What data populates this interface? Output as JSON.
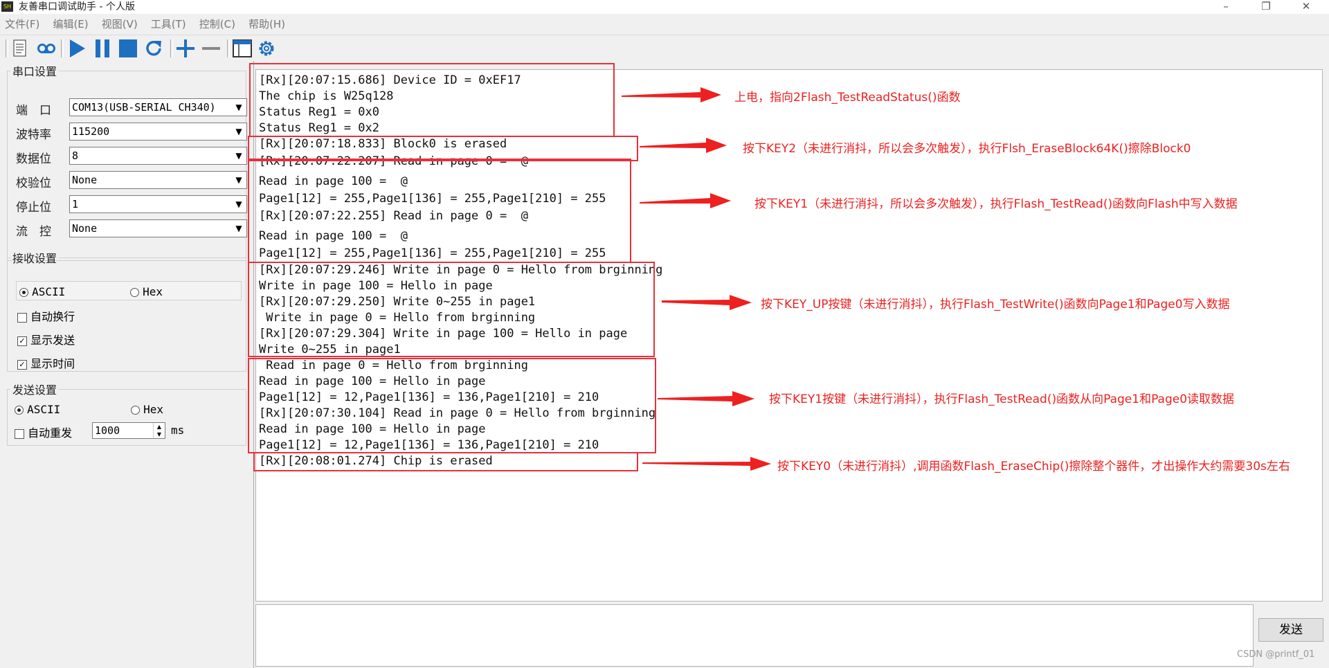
{
  "window": {
    "title": "友善串口调试助手 - 个人版",
    "icon": "app-icon"
  },
  "menu": [
    "文件(F)",
    "编辑(E)",
    "视图(V)",
    "工具(T)",
    "控制(C)",
    "帮助(H)"
  ],
  "toolbar_icons": [
    "new-document-icon",
    "record-icon",
    "play-icon",
    "pause-icon",
    "stop-icon",
    "refresh-icon",
    "add-icon",
    "remove-icon",
    "window-icon",
    "settings-gear-icon"
  ],
  "serial_settings": {
    "title": "串口设置",
    "rows": [
      {
        "label": "端　口",
        "value": "COM13(USB-SERIAL CH340)"
      },
      {
        "label": "波特率",
        "value": "115200"
      },
      {
        "label": "数据位",
        "value": "8"
      },
      {
        "label": "校验位",
        "value": "None"
      },
      {
        "label": "停止位",
        "value": "1"
      },
      {
        "label": "流　控",
        "value": "None"
      }
    ]
  },
  "receive_settings": {
    "title": "接收设置",
    "ascii": "ASCII",
    "hex": "Hex",
    "auto_wrap": "自动换行",
    "show_send": "显示发送",
    "show_time": "显示时间"
  },
  "send_settings": {
    "title": "发送设置",
    "ascii": "ASCII",
    "hex": "Hex",
    "auto_resend": "自动重发",
    "interval": "1000",
    "unit": "ms"
  },
  "receive_lines": [
    "[Rx][20:07:15.686] Device ID = 0xEF17",
    "The chip is W25q128",
    "Status Reg1 = 0x0",
    "Status Reg1 = 0x2",
    "[Rx][20:07:18.833] Block0 is erased",
    "[Rx][20:07:22.207] Read in page 0 =  @",
    "Read in page 100 =  @",
    "Page1[12] = 255,Page1[136] = 255,Page1[210] = 255",
    "[Rx][20:07:22.255] Read in page 0 =  @",
    "Read in page 100 =  @",
    "Page1[12] = 255,Page1[136] = 255,Page1[210] = 255",
    "[Rx][20:07:29.246] Write in page 0 = Hello from brginning",
    "Write in page 100 = Hello in page",
    "[Rx][20:07:29.250] Write 0~255 in page1",
    " Write in page 0 = Hello from brginning",
    "[Rx][20:07:29.304] Write in page 100 = Hello in page",
    "Write 0~255 in page1",
    " Read in page 0 = Hello from brginning",
    "Read in page 100 = Hello in page",
    "Page1[12] = 12,Page1[136] = 136,Page1[210] = 210",
    "[Rx][20:07:30.104] Read in page 0 = Hello from brginning",
    "Read in page 100 = Hello in page",
    "Page1[12] = 12,Page1[136] = 136,Page1[210] = 210",
    "[Rx][20:08:01.274] Chip is erased"
  ],
  "annotations": [
    "上电，指向2Flash_TestReadStatus()函数",
    "按下KEY2（未进行消抖，所以会多次触发），执行Flsh_EraseBlock64K()擦除Block0",
    "按下KEY1（未进行消抖，所以会多次触发），执行Flash_TestRead()函数向Flash中写入数据",
    "按下KEY_UP按键（未进行消抖），执行Flash_TestWrite()函数向Page1和Page0写入数据",
    "按下KEY1按键（未进行消抖），执行Flash_TestRead()函数从向Page1和Page0读取数据",
    "按下KEY0（未进行消抖）,调用函数Flash_EraseChip()擦除整个器件，才出操作大约需要30s左右"
  ],
  "send_button": "发送",
  "watermark": "CSDN @printf_01",
  "colors": {
    "annotation": "#ee2020",
    "toolbar_blue": "#1f6fc0"
  }
}
